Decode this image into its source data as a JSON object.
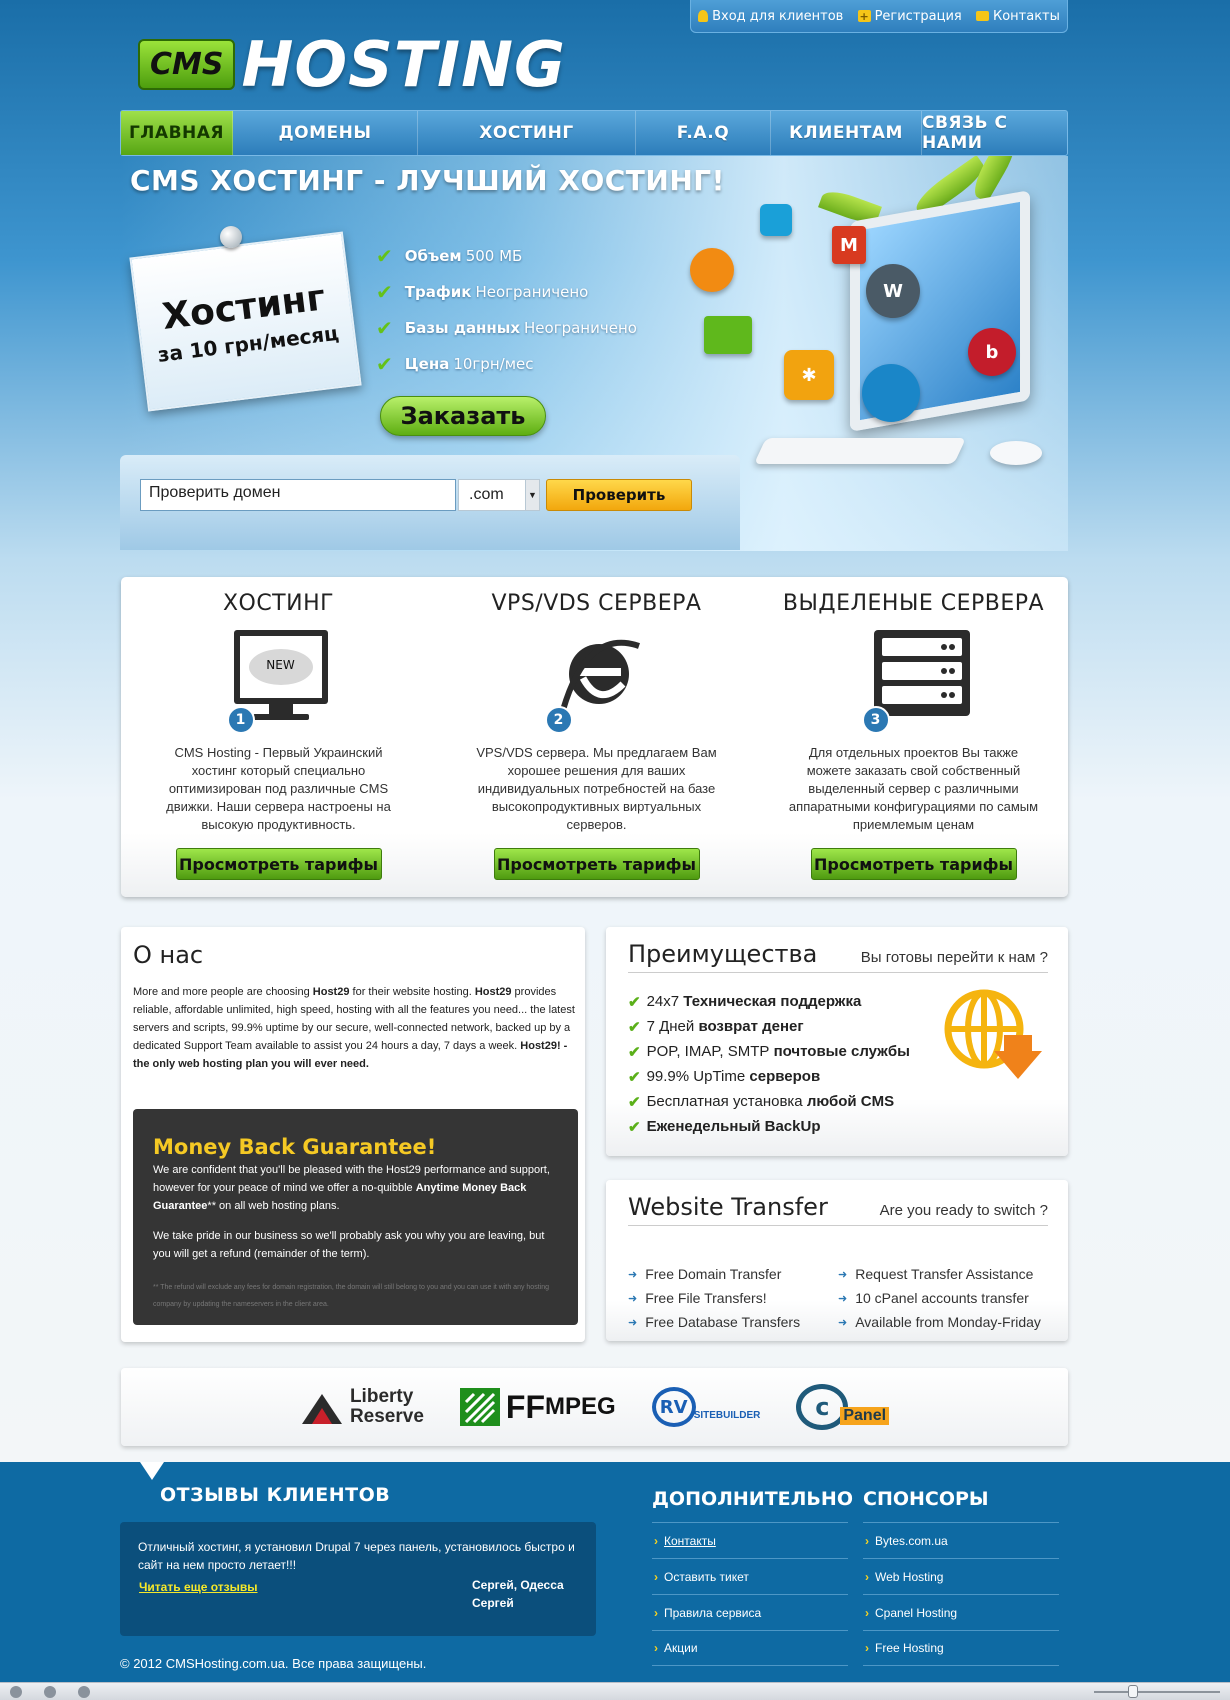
{
  "toplinks": [
    {
      "label": "Вход для клиентов",
      "icon": "key-icon",
      "color": "#f5c518"
    },
    {
      "label": "Регистрация",
      "icon": "plus-icon",
      "color": "#f5c518"
    },
    {
      "label": "Контакты",
      "icon": "mail-icon",
      "color": "#f5c518"
    }
  ],
  "logo": {
    "cms": "CMS",
    "hosting": "HOSTING"
  },
  "nav": [
    {
      "label": "ГЛАВНАЯ",
      "active": true
    },
    {
      "label": "ДОМЕНЫ"
    },
    {
      "label": "ХОСТИНГ"
    },
    {
      "label": "F.A.Q"
    },
    {
      "label": "КЛИЕНТАМ"
    },
    {
      "label": "СВЯЗЬ С НАМИ"
    }
  ],
  "hero": {
    "title": "CMS ХОСТИНГ - ЛУЧШИЙ ХОСТИНГ!",
    "note_line1": "Хостинг",
    "note_line2": "за 10 грн/месяц",
    "features": [
      {
        "label": "Объем",
        "value": "500 МБ"
      },
      {
        "label": "Трафик",
        "value": "Неограничено"
      },
      {
        "label": "Базы данных",
        "value": "Неограничено"
      },
      {
        "label": "Цена",
        "value": "10грн/мес"
      }
    ],
    "order_button": "Заказать"
  },
  "domain_check": {
    "input_value": "Проверить домен",
    "zone": ".com",
    "button": "Проверить"
  },
  "services": [
    {
      "title": "ХОСТИНГ",
      "number": "1",
      "badge": "NEW",
      "icon": "monitor-icon",
      "text": "CMS Hosting - Первый Украинский хостинг который специально оптимизирован под различные CMS движки. Наши сервера настроены на высокую продуктивность.",
      "button": "Просмотреть тарифы"
    },
    {
      "title": "VPS/VDS СЕРВЕРА",
      "number": "2",
      "icon": "internet-explorer-icon",
      "text": "VPS/VDS сервера. Мы предлагаем Вам хорошее решения для ваших индивидуальных потребностей на базе высокопродуктивных виртуальных серверов.",
      "button": "Просмотреть тарифы"
    },
    {
      "title": "ВЫДЕЛЕНЫЕ СЕРВЕРА",
      "number": "3",
      "icon": "server-rack-icon",
      "text": "Для отдельных проектов Вы также можете заказать свой собственный выделенный сервер с различными аппаратными конфигурациями по самым приемлемым ценам",
      "button": "Просмотреть тарифы"
    }
  ],
  "about": {
    "title": "О нас",
    "text_1": "More and more people are choosing ",
    "brand_1": "Host29",
    "text_2": " for their website hosting. ",
    "brand_2": "Host29",
    "text_3": " provides reliable, affordable unlimited, high speed, hosting with all the features you need... the latest servers and scripts, 99.9% uptime by our secure, well-connected network, backed up by a dedicated Support Team available to assist you 24 hours a day, 7 days a week. ",
    "tagline": "Host29! - the only web hosting plan you will ever need.",
    "mbg": {
      "title": "Money Back Guarantee!",
      "p1_a": "We are confident that you'll be pleased with the Host29 performance and support, however for your peace of mind we offer a no-quibble ",
      "p1_b": "Anytime Money Back Guarantee",
      "p1_c": "** on all web hosting plans.",
      "p2": "We take pride in our business so we'll probably ask you why you are leaving, but you will get a refund (remainder of the term).",
      "fine": "** The refund will exclude any fees for domain registration, the domain will still belong to you and you can use it with any hosting company by updating the nameservers in the client area."
    }
  },
  "advantages": {
    "title": "Преимущества",
    "subtitle": "Вы готовы перейти к нам ?",
    "items": [
      {
        "a": "24x7",
        "b": "Техническая поддержка"
      },
      {
        "a": "7 Дней",
        "b": "возврат денег"
      },
      {
        "a": "POP, IMAP, SMTP",
        "b": "почтовые службы"
      },
      {
        "a": "99.9% UpTime",
        "b": "серверов"
      },
      {
        "a": "Бесплатная установка",
        "b": "любой CMS"
      },
      {
        "a": "",
        "b": "Еженедельный BackUp"
      }
    ]
  },
  "transfer": {
    "title": "Website Transfer",
    "subtitle": "Are you ready to switch ?",
    "left": [
      "Free Domain Transfer",
      "Free File Transfers!",
      "Free Database Transfers"
    ],
    "right": [
      "Request Transfer Assistance",
      "10 cPanel accounts transfer",
      "Available from Monday-Friday"
    ]
  },
  "partners": [
    {
      "line1": "Liberty",
      "line2": "Reserve"
    },
    {
      "line1": "FF",
      "line2": "MPEG"
    },
    {
      "line1": "RV",
      "line2": "SITEBUILDER"
    },
    {
      "line1": "c",
      "line2": "Panel"
    }
  ],
  "footer": {
    "reviews_title": "ОТЗЫВЫ КЛИЕНТОВ",
    "review_text": "Отличный хостинг, я установил Drupal 7 через панель, установилось быстро и сайт на нем просто летает!!!",
    "review_more": "Читать еще отзывы",
    "review_author_1": "Сергей, Одесса",
    "review_author_2": "Сергей",
    "extra_title": "ДОПОЛНИТЕЛЬНО",
    "extra_links": [
      "Контакты",
      "Оставить тикет",
      "Правила сервиса",
      "Акции"
    ],
    "sponsors_title": "СПОНСОРЫ",
    "sponsor_links": [
      "Bytes.com.ua",
      "Web Hosting",
      "Cpanel Hosting",
      "Free Hosting"
    ],
    "copyright": "© 2012 CMSHosting.com.ua. Все права защищены."
  }
}
